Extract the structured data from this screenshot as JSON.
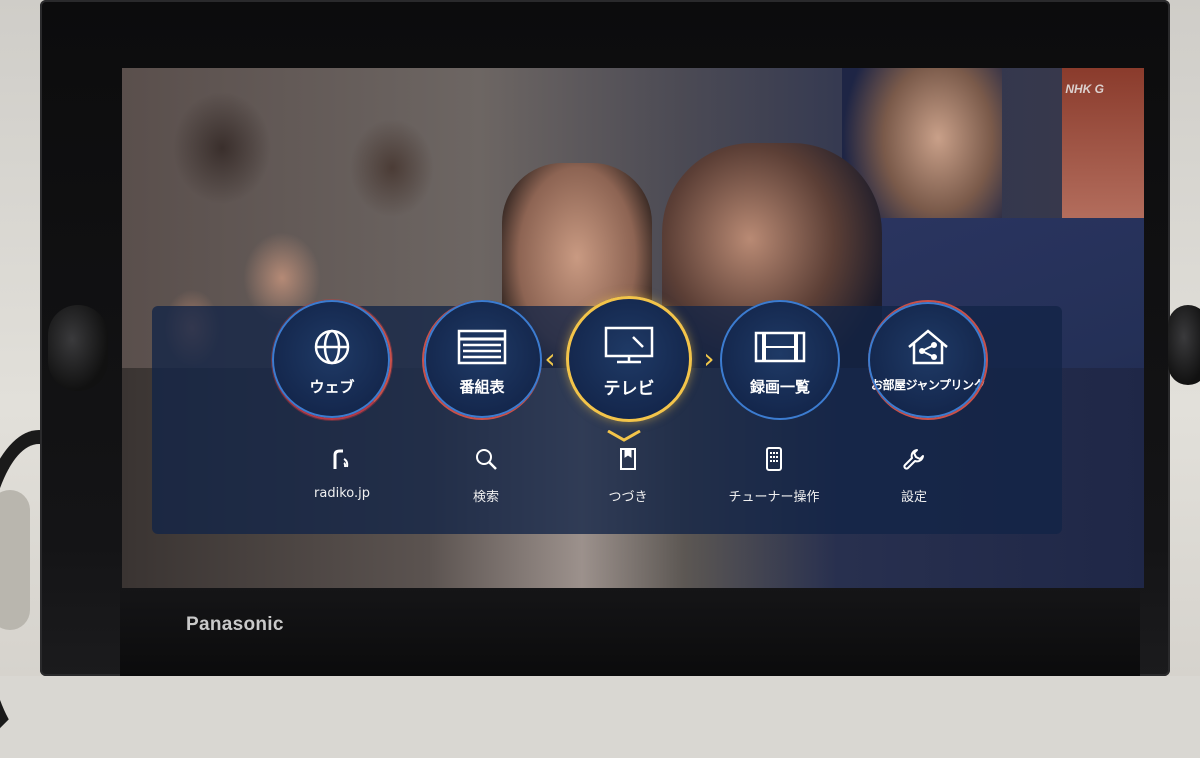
{
  "device": {
    "brand": "Panasonic"
  },
  "broadcast": {
    "channel_logo": "NHK G"
  },
  "menu": {
    "selected": "テレビ",
    "main_items": [
      {
        "id": "web",
        "label": "ウェブ",
        "icon": "globe-icon"
      },
      {
        "id": "guide",
        "label": "番組表",
        "icon": "program-guide-icon"
      },
      {
        "id": "tv",
        "label": "テレビ",
        "icon": "tv-icon",
        "selected": true
      },
      {
        "id": "recordings",
        "label": "録画一覧",
        "icon": "film-strip-icon"
      },
      {
        "id": "jump",
        "label": "お部屋ジャンプリンク",
        "icon": "home-share-icon"
      }
    ],
    "sub_items": [
      {
        "id": "radiko",
        "label": "radiko.jp",
        "icon": "radiko-icon"
      },
      {
        "id": "search",
        "label": "検索",
        "icon": "search-icon"
      },
      {
        "id": "continue",
        "label": "つづき",
        "icon": "bookmark-icon"
      },
      {
        "id": "tuner",
        "label": "チューナー操作",
        "icon": "remote-icon"
      },
      {
        "id": "settings",
        "label": "設定",
        "icon": "wrench-icon"
      }
    ],
    "colors": {
      "selected_ring": "#f3c44a",
      "ring_blue": "#3c7cd0",
      "ring_red": "#c9514a",
      "panel": "#122446"
    }
  }
}
